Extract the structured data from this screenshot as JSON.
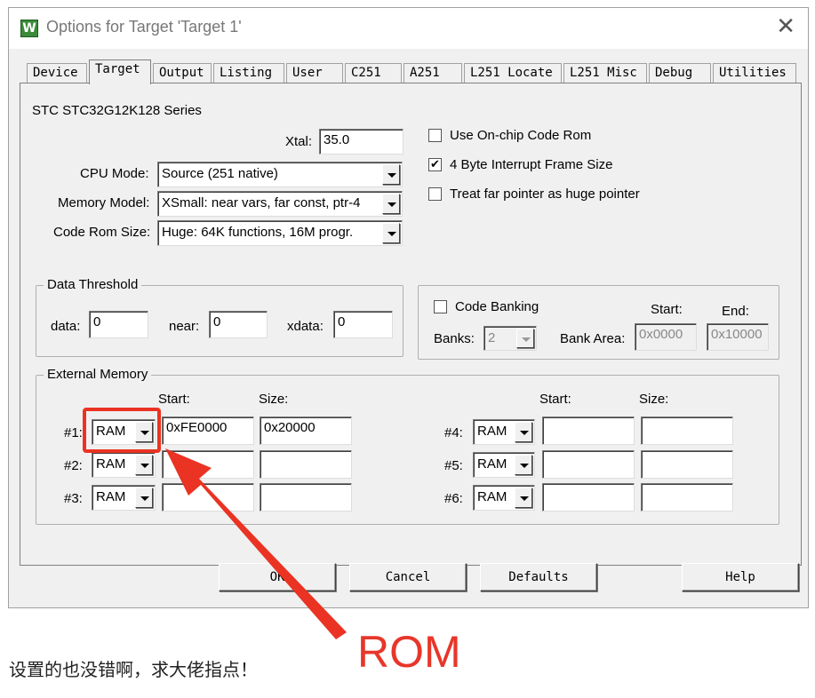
{
  "dialog": {
    "title": "Options for Target 'Target 1'"
  },
  "tabs": [
    "Device",
    "Target",
    "Output",
    "Listing",
    "User",
    "C251",
    "A251",
    "L251 Locate",
    "L251 Misc",
    "Debug",
    "Utilities"
  ],
  "series_name": "STC STC32G12K128 Series",
  "xtal": {
    "label": "Xtal:",
    "value": "35.0"
  },
  "cpu_mode": {
    "label": "CPU Mode:",
    "value": "Source (251 native)"
  },
  "memory_model": {
    "label": "Memory Model:",
    "value": "XSmall: near vars, far const, ptr-4"
  },
  "code_rom_size": {
    "label": "Code Rom Size:",
    "value": "Huge: 64K functions, 16M progr."
  },
  "options": [
    {
      "label": "Use On-chip Code Rom",
      "checked": false
    },
    {
      "label": "4 Byte Interrupt Frame Size",
      "checked": true
    },
    {
      "label": "Treat far pointer as huge pointer",
      "checked": false
    }
  ],
  "data_threshold": {
    "title": "Data Threshold",
    "data_label": "data:",
    "data_value": "0",
    "near_label": "near:",
    "near_value": "0",
    "xdata_label": "xdata:",
    "xdata_value": "0"
  },
  "code_banking": {
    "label": "Code Banking",
    "checked": false,
    "banks_label": "Banks:",
    "banks_value": "2",
    "bank_area_label": "Bank Area:",
    "start_label": "Start:",
    "end_label": "End:",
    "start_value": "0x0000",
    "end_value": "0x10000"
  },
  "external_memory": {
    "title": "External Memory",
    "start_label": "Start:",
    "size_label": "Size:",
    "rows": [
      {
        "label": "#1:",
        "type": "RAM",
        "start": "0xFE0000",
        "size": "0x20000"
      },
      {
        "label": "#2:",
        "type": "RAM",
        "start": "",
        "size": ""
      },
      {
        "label": "#3:",
        "type": "RAM",
        "start": "",
        "size": ""
      },
      {
        "label": "#4:",
        "type": "RAM",
        "start": "",
        "size": ""
      },
      {
        "label": "#5:",
        "type": "RAM",
        "start": "",
        "size": ""
      },
      {
        "label": "#6:",
        "type": "RAM",
        "start": "",
        "size": ""
      }
    ]
  },
  "buttons": {
    "ok": "OK",
    "cancel": "Cancel",
    "defaults": "Defaults",
    "help": "Help"
  },
  "annotation": {
    "caption": "设置的也没错啊，求大佬指点！",
    "rom_text": "ROM",
    "color": "#e8362a"
  }
}
